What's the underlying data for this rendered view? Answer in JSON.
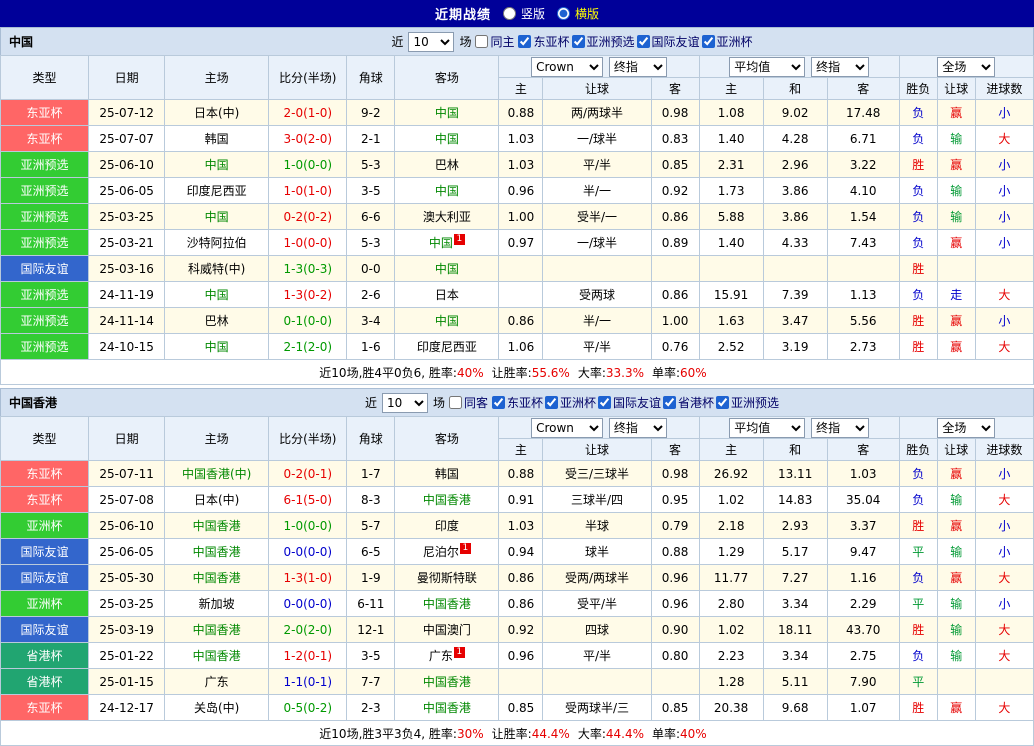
{
  "topbar": {
    "title": "近期战绩",
    "vertical_label": "竖版",
    "horizontal_label": "横版"
  },
  "columns": {
    "type": "类型",
    "date": "日期",
    "home": "主场",
    "score": "比分(半场)",
    "corner": "角球",
    "away": "客场",
    "asia_home": "主",
    "asia_handicap": "让球",
    "asia_away": "客",
    "euro_home": "主",
    "euro_draw": "和",
    "euro_away": "客",
    "result_wl": "胜负",
    "result_handicap": "让球",
    "result_goals": "进球数"
  },
  "controls": {
    "company": "Crown",
    "final": "终指",
    "average": "平均值",
    "scope": "全场"
  },
  "colors": {
    "focus_team": "#008800",
    "topbar_bg": "#000099",
    "accent_red": "#e60000"
  },
  "type_colors": {
    "东亚杯": "#ff6666",
    "亚洲预选": "#33cc33",
    "国际友谊": "#3366cc",
    "亚洲杯": "#33cc33",
    "省港杯": "#21a571"
  },
  "score_colors": {
    "win": "#009900",
    "draw": "#0000cc",
    "loss": "#e60000"
  },
  "result_colors": {
    "胜": "#e60000",
    "平": "#009933",
    "负": "#0000cc",
    "赢": "#e60000",
    "输": "#009933",
    "走": "#0000cc",
    "大": "#e60000",
    "小": "#0000cc"
  },
  "sections": [
    {
      "name": "中国",
      "filter": {
        "near_label": "近",
        "count": "10",
        "matches_label": "场",
        "same_label": "同主",
        "same_checked": false,
        "competitions": [
          "东亚杯",
          "亚洲预选",
          "国际友谊",
          "亚洲杯"
        ]
      },
      "rows": [
        {
          "type": "东亚杯",
          "date": "25-07-12",
          "home": "日本(中)",
          "home_focus": false,
          "home_mark": "",
          "score": "2-0(1-0)",
          "result": "loss",
          "corner": "9-2",
          "away": "中国",
          "away_focus": true,
          "away_mark": "",
          "asia_home": "0.88",
          "asia_handicap": "两/两球半",
          "asia_away": "0.98",
          "euro_home": "1.08",
          "euro_draw": "9.02",
          "euro_away": "17.48",
          "wl": "负",
          "hc": "赢",
          "goals": "小"
        },
        {
          "type": "东亚杯",
          "date": "25-07-07",
          "home": "韩国",
          "home_focus": false,
          "home_mark": "",
          "score": "3-0(2-0)",
          "result": "loss",
          "corner": "2-1",
          "away": "中国",
          "away_focus": true,
          "away_mark": "",
          "asia_home": "1.03",
          "asia_handicap": "一/球半",
          "asia_away": "0.83",
          "euro_home": "1.40",
          "euro_draw": "4.28",
          "euro_away": "6.71",
          "wl": "负",
          "hc": "输",
          "goals": "大"
        },
        {
          "type": "亚洲预选",
          "date": "25-06-10",
          "home": "中国",
          "home_focus": true,
          "home_mark": "",
          "score": "1-0(0-0)",
          "result": "win",
          "corner": "5-3",
          "away": "巴林",
          "away_focus": false,
          "away_mark": "",
          "asia_home": "1.03",
          "asia_handicap": "平/半",
          "asia_away": "0.85",
          "euro_home": "2.31",
          "euro_draw": "2.96",
          "euro_away": "3.22",
          "wl": "胜",
          "hc": "赢",
          "goals": "小"
        },
        {
          "type": "亚洲预选",
          "date": "25-06-05",
          "home": "印度尼西亚",
          "home_focus": false,
          "home_mark": "",
          "score": "1-0(1-0)",
          "result": "loss",
          "corner": "3-5",
          "away": "中国",
          "away_focus": true,
          "away_mark": "",
          "asia_home": "0.96",
          "asia_handicap": "半/一",
          "asia_away": "0.92",
          "euro_home": "1.73",
          "euro_draw": "3.86",
          "euro_away": "4.10",
          "wl": "负",
          "hc": "输",
          "goals": "小"
        },
        {
          "type": "亚洲预选",
          "date": "25-03-25",
          "home": "中国",
          "home_focus": true,
          "home_mark": "",
          "score": "0-2(0-2)",
          "result": "loss",
          "corner": "6-6",
          "away": "澳大利亚",
          "away_focus": false,
          "away_mark": "",
          "asia_home": "1.00",
          "asia_handicap": "受半/一",
          "asia_away": "0.86",
          "euro_home": "5.88",
          "euro_draw": "3.86",
          "euro_away": "1.54",
          "wl": "负",
          "hc": "输",
          "goals": "小"
        },
        {
          "type": "亚洲预选",
          "date": "25-03-21",
          "home": "沙特阿拉伯",
          "home_focus": false,
          "home_mark": "",
          "score": "1-0(0-0)",
          "result": "loss",
          "corner": "5-3",
          "away": "中国",
          "away_focus": true,
          "away_mark": "1",
          "asia_home": "0.97",
          "asia_handicap": "一/球半",
          "asia_away": "0.89",
          "euro_home": "1.40",
          "euro_draw": "4.33",
          "euro_away": "7.43",
          "wl": "负",
          "hc": "赢",
          "goals": "小"
        },
        {
          "type": "国际友谊",
          "date": "25-03-16",
          "home": "科威特(中)",
          "home_focus": false,
          "home_mark": "",
          "score": "1-3(0-3)",
          "result": "win",
          "corner": "0-0",
          "away": "中国",
          "away_focus": true,
          "away_mark": "",
          "asia_home": "",
          "asia_handicap": "",
          "asia_away": "",
          "euro_home": "",
          "euro_draw": "",
          "euro_away": "",
          "wl": "胜",
          "hc": "",
          "goals": ""
        },
        {
          "type": "亚洲预选",
          "date": "24-11-19",
          "home": "中国",
          "home_focus": true,
          "home_mark": "",
          "score": "1-3(0-2)",
          "result": "loss",
          "corner": "2-6",
          "away": "日本",
          "away_focus": false,
          "away_mark": "",
          "asia_home": "",
          "asia_handicap": "受两球",
          "asia_away": "0.86",
          "euro_home": "15.91",
          "euro_draw": "7.39",
          "euro_away": "1.13",
          "wl": "负",
          "hc": "走",
          "goals": "大"
        },
        {
          "type": "亚洲预选",
          "date": "24-11-14",
          "home": "巴林",
          "home_focus": false,
          "home_mark": "",
          "score": "0-1(0-0)",
          "result": "win",
          "corner": "3-4",
          "away": "中国",
          "away_focus": true,
          "away_mark": "",
          "asia_home": "0.86",
          "asia_handicap": "半/一",
          "asia_away": "1.00",
          "euro_home": "1.63",
          "euro_draw": "3.47",
          "euro_away": "5.56",
          "wl": "胜",
          "hc": "赢",
          "goals": "小"
        },
        {
          "type": "亚洲预选",
          "date": "24-10-15",
          "home": "中国",
          "home_focus": true,
          "home_mark": "",
          "score": "2-1(2-0)",
          "result": "win",
          "corner": "1-6",
          "away": "印度尼西亚",
          "away_focus": false,
          "away_mark": "",
          "asia_home": "1.06",
          "asia_handicap": "平/半",
          "asia_away": "0.76",
          "euro_home": "2.52",
          "euro_draw": "3.19",
          "euro_away": "2.73",
          "wl": "胜",
          "hc": "赢",
          "goals": "大"
        }
      ],
      "summary": {
        "prefix": "近10场,胜4平0负6, ",
        "stats": [
          {
            "label": "胜率:",
            "value": "40%"
          },
          {
            "label": "让胜率:",
            "value": "55.6%"
          },
          {
            "label": "大率:",
            "value": "33.3%"
          },
          {
            "label": "单率:",
            "value": "60%"
          }
        ]
      }
    },
    {
      "name": "中国香港",
      "filter": {
        "near_label": "近",
        "count": "10",
        "matches_label": "场",
        "same_label": "同客",
        "same_checked": false,
        "competitions": [
          "东亚杯",
          "亚洲杯",
          "国际友谊",
          "省港杯",
          "亚洲预选"
        ]
      },
      "rows": [
        {
          "type": "东亚杯",
          "date": "25-07-11",
          "home": "中国香港(中)",
          "home_focus": true,
          "home_mark": "",
          "score": "0-2(0-1)",
          "result": "loss",
          "corner": "1-7",
          "away": "韩国",
          "away_focus": false,
          "away_mark": "",
          "asia_home": "0.88",
          "asia_handicap": "受三/三球半",
          "asia_away": "0.98",
          "euro_home": "26.92",
          "euro_draw": "13.11",
          "euro_away": "1.03",
          "wl": "负",
          "hc": "赢",
          "goals": "小"
        },
        {
          "type": "东亚杯",
          "date": "25-07-08",
          "home": "日本(中)",
          "home_focus": false,
          "home_mark": "",
          "score": "6-1(5-0)",
          "result": "loss",
          "corner": "8-3",
          "away": "中国香港",
          "away_focus": true,
          "away_mark": "",
          "asia_home": "0.91",
          "asia_handicap": "三球半/四",
          "asia_away": "0.95",
          "euro_home": "1.02",
          "euro_draw": "14.83",
          "euro_away": "35.04",
          "wl": "负",
          "hc": "输",
          "goals": "大"
        },
        {
          "type": "亚洲杯",
          "date": "25-06-10",
          "home": "中国香港",
          "home_focus": true,
          "home_mark": "",
          "score": "1-0(0-0)",
          "result": "win",
          "corner": "5-7",
          "away": "印度",
          "away_focus": false,
          "away_mark": "",
          "asia_home": "1.03",
          "asia_handicap": "半球",
          "asia_away": "0.79",
          "euro_home": "2.18",
          "euro_draw": "2.93",
          "euro_away": "3.37",
          "wl": "胜",
          "hc": "赢",
          "goals": "小"
        },
        {
          "type": "国际友谊",
          "date": "25-06-05",
          "home": "中国香港",
          "home_focus": true,
          "home_mark": "",
          "score": "0-0(0-0)",
          "result": "draw",
          "corner": "6-5",
          "away": "尼泊尔",
          "away_focus": false,
          "away_mark": "1",
          "asia_home": "0.94",
          "asia_handicap": "球半",
          "asia_away": "0.88",
          "euro_home": "1.29",
          "euro_draw": "5.17",
          "euro_away": "9.47",
          "wl": "平",
          "hc": "输",
          "goals": "小"
        },
        {
          "type": "国际友谊",
          "date": "25-05-30",
          "home": "中国香港",
          "home_focus": true,
          "home_mark": "",
          "score": "1-3(1-0)",
          "result": "loss",
          "corner": "1-9",
          "away": "曼彻斯特联",
          "away_focus": false,
          "away_mark": "",
          "asia_home": "0.86",
          "asia_handicap": "受两/两球半",
          "asia_away": "0.96",
          "euro_home": "11.77",
          "euro_draw": "7.27",
          "euro_away": "1.16",
          "wl": "负",
          "hc": "赢",
          "goals": "大"
        },
        {
          "type": "亚洲杯",
          "date": "25-03-25",
          "home": "新加坡",
          "home_focus": false,
          "home_mark": "",
          "score": "0-0(0-0)",
          "result": "draw",
          "corner": "6-11",
          "away": "中国香港",
          "away_focus": true,
          "away_mark": "",
          "asia_home": "0.86",
          "asia_handicap": "受平/半",
          "asia_away": "0.96",
          "euro_home": "2.80",
          "euro_draw": "3.34",
          "euro_away": "2.29",
          "wl": "平",
          "hc": "输",
          "goals": "小"
        },
        {
          "type": "国际友谊",
          "date": "25-03-19",
          "home": "中国香港",
          "home_focus": true,
          "home_mark": "",
          "score": "2-0(2-0)",
          "result": "win",
          "corner": "12-1",
          "away": "中国澳门",
          "away_focus": false,
          "away_mark": "",
          "asia_home": "0.92",
          "asia_handicap": "四球",
          "asia_away": "0.90",
          "euro_home": "1.02",
          "euro_draw": "18.11",
          "euro_away": "43.70",
          "wl": "胜",
          "hc": "输",
          "goals": "大"
        },
        {
          "type": "省港杯",
          "date": "25-01-22",
          "home": "中国香港",
          "home_focus": true,
          "home_mark": "",
          "score": "1-2(0-1)",
          "result": "loss",
          "corner": "3-5",
          "away": "广东",
          "away_focus": false,
          "away_mark": "1",
          "asia_home": "0.96",
          "asia_handicap": "平/半",
          "asia_away": "0.80",
          "euro_home": "2.23",
          "euro_draw": "3.34",
          "euro_away": "2.75",
          "wl": "负",
          "hc": "输",
          "goals": "大"
        },
        {
          "type": "省港杯",
          "date": "25-01-15",
          "home": "广东",
          "home_focus": false,
          "home_mark": "",
          "score": "1-1(0-1)",
          "result": "draw",
          "corner": "7-7",
          "away": "中国香港",
          "away_focus": true,
          "away_mark": "",
          "asia_home": "",
          "asia_handicap": "",
          "asia_away": "",
          "euro_home": "1.28",
          "euro_draw": "5.11",
          "euro_away": "7.90",
          "wl": "平",
          "hc": "",
          "goals": ""
        },
        {
          "type": "东亚杯",
          "date": "24-12-17",
          "home": "关岛(中)",
          "home_focus": false,
          "home_mark": "",
          "score": "0-5(0-2)",
          "result": "win",
          "corner": "2-3",
          "away": "中国香港",
          "away_focus": true,
          "away_mark": "",
          "asia_home": "0.85",
          "asia_handicap": "受两球半/三",
          "asia_away": "0.85",
          "euro_home": "20.38",
          "euro_draw": "9.68",
          "euro_away": "1.07",
          "wl": "胜",
          "hc": "赢",
          "goals": "大"
        }
      ],
      "summary": {
        "prefix": "近10场,胜3平3负4, ",
        "stats": [
          {
            "label": "胜率:",
            "value": "30%"
          },
          {
            "label": "让胜率:",
            "value": "44.4%"
          },
          {
            "label": "大率:",
            "value": "44.4%"
          },
          {
            "label": "单率:",
            "value": "40%"
          }
        ]
      }
    }
  ]
}
